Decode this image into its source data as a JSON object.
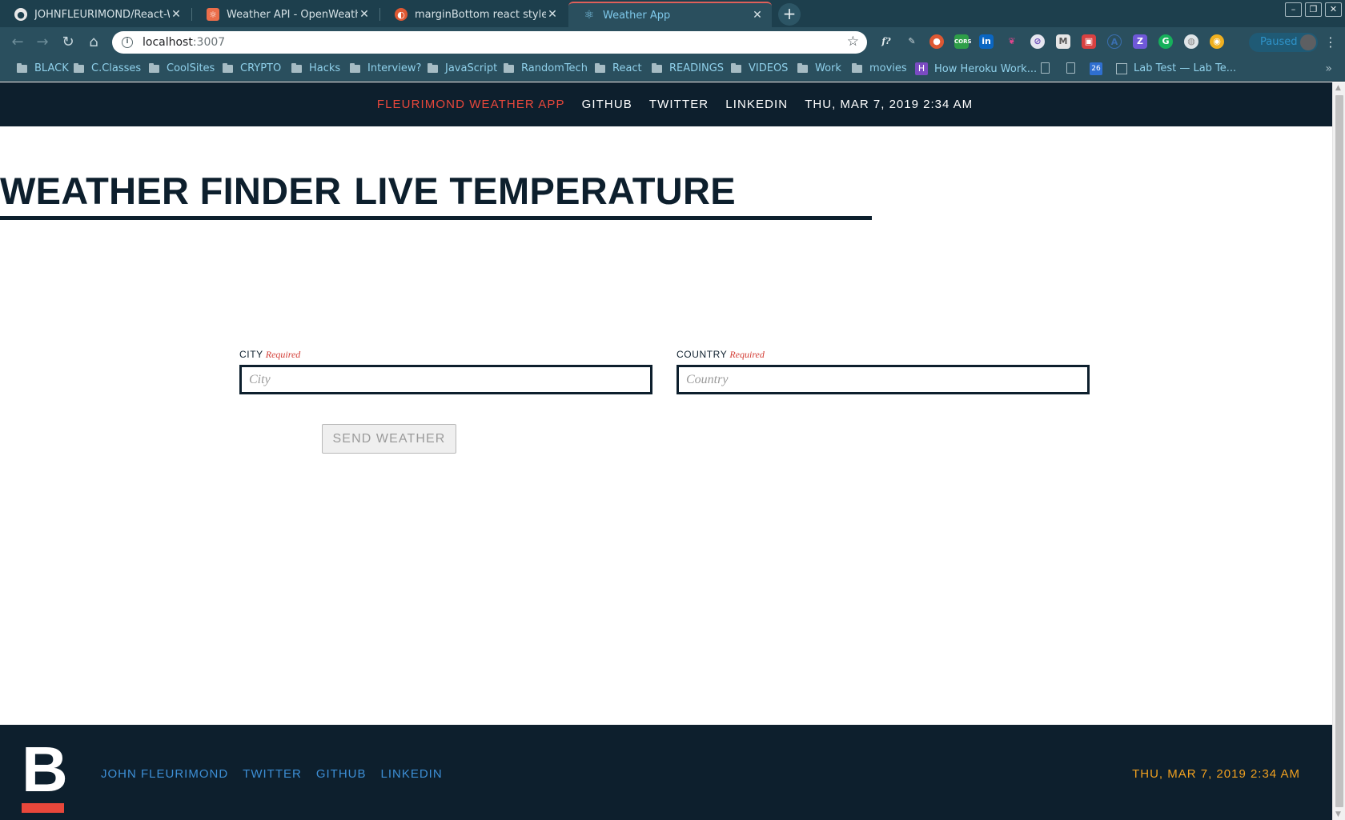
{
  "browser": {
    "tabs": [
      {
        "title": "JOHNFLEURIMOND/React-Weat",
        "favicon": "github-icon"
      },
      {
        "title": "Weather API - OpenWeatherMa",
        "favicon": "openweathermap-icon"
      },
      {
        "title": "marginBottom react style jsx at",
        "favicon": "duckduckgo-icon"
      },
      {
        "title": "Weather App",
        "favicon": "react-icon"
      }
    ],
    "address": {
      "host": "localhost",
      "port": ":3007"
    },
    "profile_status": "Paused",
    "bookmarks": [
      "BLACK",
      "C.Classes",
      "CoolSites",
      "CRYPTO",
      "Hacks",
      "Interview?",
      "JavaScript",
      "RandomTech",
      "React",
      "READINGS",
      "VIDEOS",
      "Work",
      "movies",
      "How Heroku Work...",
      "Lab Test — Lab Te..."
    ],
    "calendar_day": "26"
  },
  "nav": {
    "brand": "FLEURIMOND WEATHER APP",
    "links": [
      "GITHUB",
      "TWITTER",
      "LINKEDIN"
    ],
    "datetime": "THU, MAR 7, 2019 2:34 AM"
  },
  "hero": {
    "title_left": "WEATHER FINDER",
    "title_right": "LIVE TEMPERATURE"
  },
  "form": {
    "city": {
      "label": "CITY",
      "required": "Required",
      "placeholder": "City",
      "value": ""
    },
    "country": {
      "label": "COUNTRY",
      "required": "Required",
      "placeholder": "Country",
      "value": ""
    },
    "submit_label": "SEND WEATHER"
  },
  "footer": {
    "logo_letter": "B",
    "links": [
      "JOHN FLEURIMOND",
      "TWITTER",
      "GITHUB",
      "LINKEDIN"
    ],
    "datetime": "THU, MAR 7, 2019 2:34 AM"
  },
  "colors": {
    "navy": "#0d1f2d",
    "accent_red": "#e8473b",
    "link_blue": "#3d8fd6",
    "date_orange": "#f0a020",
    "chrome_teal": "#2a4f5e"
  }
}
